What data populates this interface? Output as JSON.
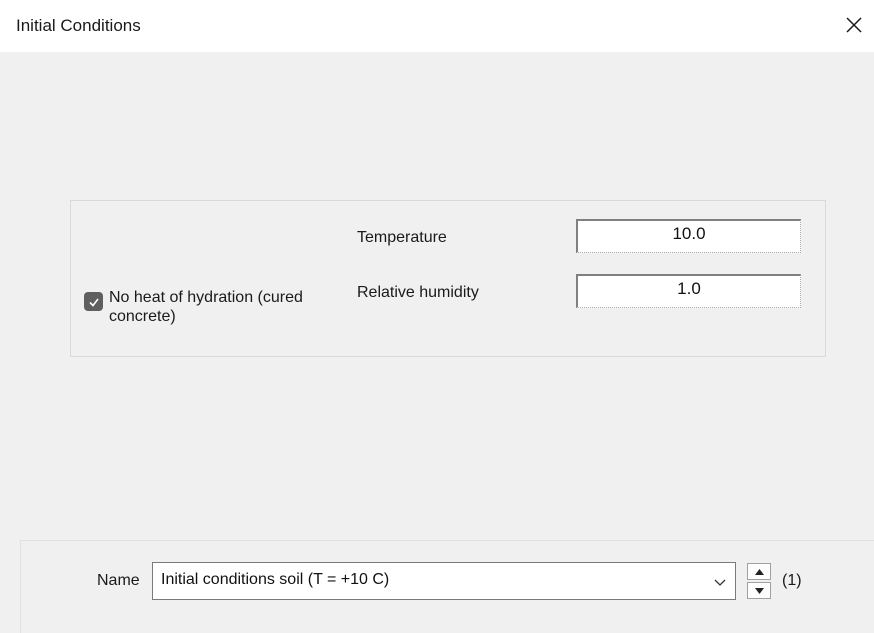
{
  "window": {
    "title": "Initial Conditions",
    "close_icon": "close-icon"
  },
  "fields": {
    "temperature": {
      "label": "Temperature",
      "value": "10.0"
    },
    "relative_humidity": {
      "label": "Relative humidity",
      "value": "1.0"
    }
  },
  "checkbox": {
    "label": "No heat of hydration (cured concrete)",
    "checked": true
  },
  "footer": {
    "name_label": "Name",
    "name_value": "Initial conditions soil (T = +10 C)",
    "counter": "(1)"
  },
  "icons": {
    "dropdown": "chevron-down-icon",
    "spin_up": "spin-up-icon",
    "spin_down": "spin-down-icon",
    "check": "checkmark-icon"
  }
}
